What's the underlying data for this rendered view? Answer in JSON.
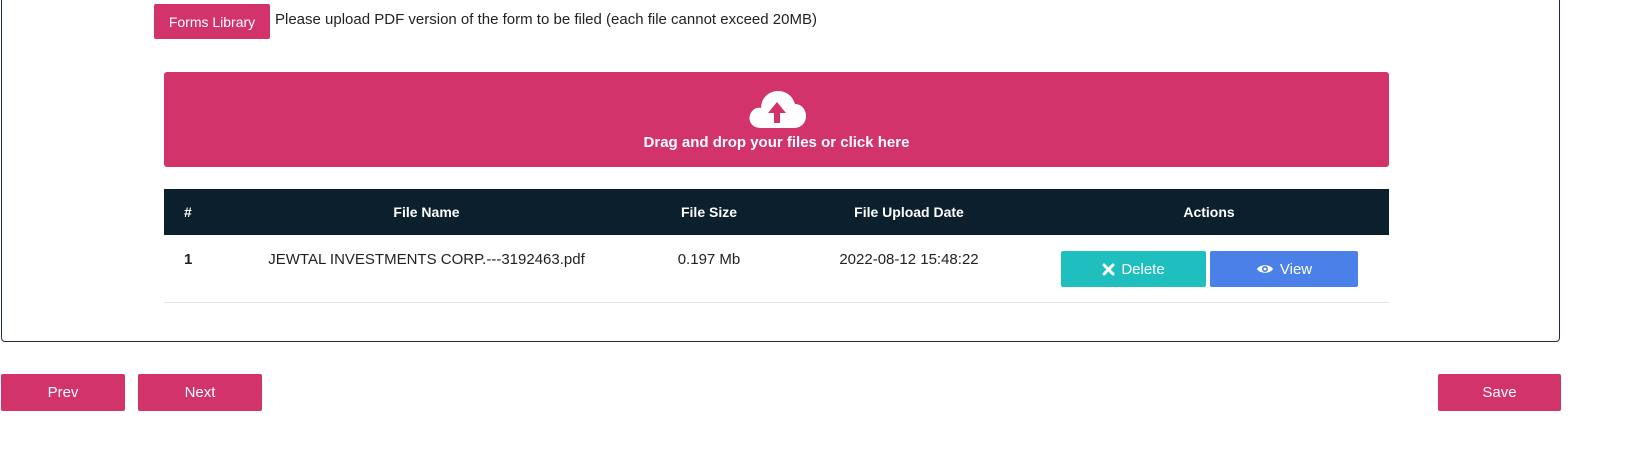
{
  "forms_library_label": "Forms Library",
  "instructions": "Please upload PDF version of the form to be filed (each file cannot exceed 20MB)",
  "dropzone": {
    "icon": "cloud-upload-icon",
    "text": "Drag and drop your files or click here"
  },
  "table": {
    "headers": [
      "#",
      "File Name",
      "File Size",
      "File Upload Date",
      "Actions"
    ],
    "rows": [
      {
        "num": "1",
        "file_name": "JEWTAL INVESTMENTS CORP.---3192463.pdf",
        "file_size": "0.197 Mb",
        "upload_date": "2022-08-12 15:48:22",
        "delete_label": "Delete",
        "view_label": "View"
      }
    ]
  },
  "nav": {
    "prev_label": "Prev",
    "next_label": "Next",
    "save_label": "Save"
  },
  "colors": {
    "primary": "#d1336a",
    "header_dark": "#0b1f2c",
    "delete": "#1fbfbf",
    "view": "#4a80e8"
  }
}
